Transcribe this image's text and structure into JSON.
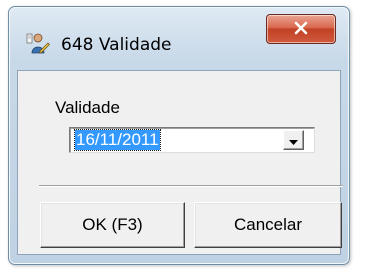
{
  "window": {
    "title": "648 Validade",
    "icon": "person-edit-icon",
    "close_icon": "close-icon"
  },
  "form": {
    "validade_label": "Validade",
    "validade_value": "16/11/2011",
    "dropdown_icon": "chevron-down-icon"
  },
  "buttons": {
    "ok_label": "OK (F3)",
    "cancel_label": "Cancelar"
  },
  "colors": {
    "selection": "#3399ff",
    "close_button": "#c24124",
    "frame": "#bfd2e3",
    "dialog_background": "#f0f0f0"
  }
}
